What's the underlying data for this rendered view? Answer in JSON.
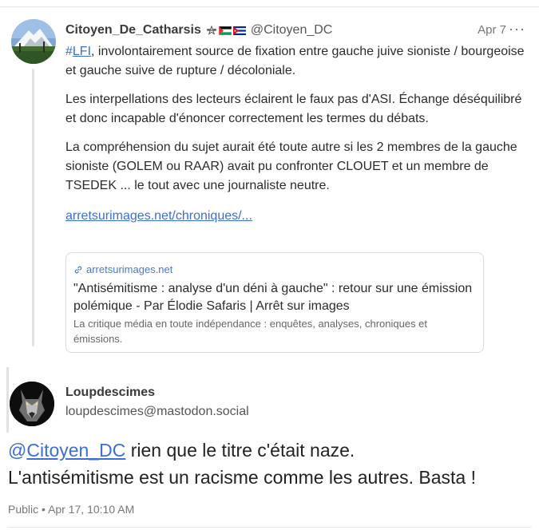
{
  "post1": {
    "display_name": "Citoyen_De_Catharsis",
    "handle": "@Citoyen_DC",
    "date": "Apr 7",
    "more_label": "···",
    "hashtag_symbol": "#",
    "hashtag_text": "LFI",
    "para1_rest": ", involontairement source de fixation entre gauche juive sioniste / bourgeoise et gauche suive de rupture / décoloniale.",
    "para2": "Les interpellations des lecteurs éclairent le faux pas d'ASI. Échange déséquilibré et donc incapable d'énoncer correctement les termes du débats.",
    "para3": "La compréhension du sujet aurait été toute autre si les 2 membres de la gauche sioniste (GOLEM ou RAAR) avait pu confronter CLOUET et un membre de TSEDEK ... le tout avec une journaliste neutre.",
    "link_text": "arretsurimages.net/chroniques/..."
  },
  "card": {
    "domain": "arretsurimages.net",
    "title": "\"Antisémitisme : analyse d'un déni à gauche\" : retour sur une émission polémique - Par Élodie Safaris | Arrêt sur images",
    "description": "La critique média en toute indépendance : enquêtes, analyses, chroniques et émissions."
  },
  "post2": {
    "display_name": "Loupdescimes",
    "handle": "loupdescimes@mastodon.social",
    "mention_at": "@",
    "mention_name": "Citoyen_DC",
    "line1_rest": " rien que le titre c'était naze.",
    "line2": "L'antisémitisme est un racisme comme les autres. Basta !",
    "visibility": "Public",
    "separator": "•",
    "timestamp": "Apr 17, 10:10 AM"
  },
  "icons": {
    "link": "link-icon",
    "flag_strikethrough_star": "flag-star-icon",
    "flag_palestine": "flag-palestine-icon",
    "flag_cuba": "flag-cuba-icon"
  },
  "colors": {
    "accent": "#3c6fd1",
    "muted": "#777777",
    "border": "#dcdcdc"
  }
}
